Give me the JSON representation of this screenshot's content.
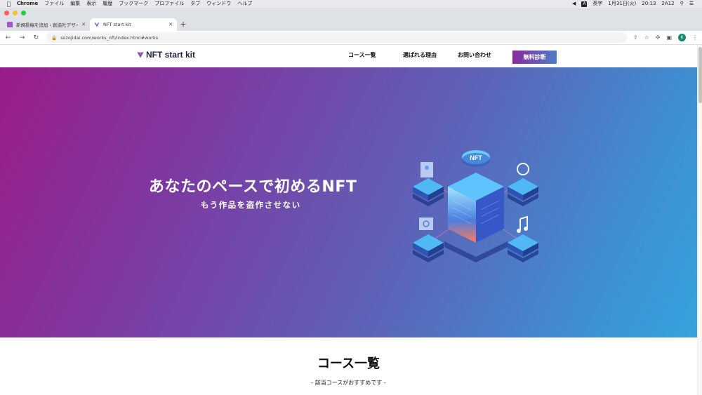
{
  "menubar": {
    "app_name": "Chrome",
    "items": [
      "ファイル",
      "編集",
      "表示",
      "履歴",
      "ブックマーク",
      "プロファイル",
      "タブ",
      "ウィンドウ",
      "ヘルプ"
    ],
    "ime_glyph": "A",
    "ime_label": "英字",
    "date": "1月31日(火)",
    "time": "20:13",
    "user": "2A12"
  },
  "tabs": [
    {
      "title": "新規投稿を追加 ‹ 創造社デザイ…",
      "active": false
    },
    {
      "title": "NFT start kit",
      "active": true
    }
  ],
  "toolbar": {
    "url": "sozojidai.com/works_nft/index.html#works",
    "profile_initial": "K"
  },
  "site": {
    "logo_text": "NFT start kit",
    "nav": [
      "コース一覧",
      "選ばれる理由",
      "お問い合わせ"
    ],
    "cta_label": "無料診断"
  },
  "hero": {
    "title": "あなたのペースで初めるNFT",
    "subtitle": "もう作品を盗作させない",
    "badge_text": "NFT"
  },
  "courses": {
    "title": "コース一覧",
    "subtitle": "- 該当コースがおすすめです -"
  },
  "colors": {
    "accent_purple": "#9a1c89",
    "accent_blue": "#33a3dd",
    "cta_from": "#8a2a9b",
    "cta_to": "#4d7dc9"
  }
}
